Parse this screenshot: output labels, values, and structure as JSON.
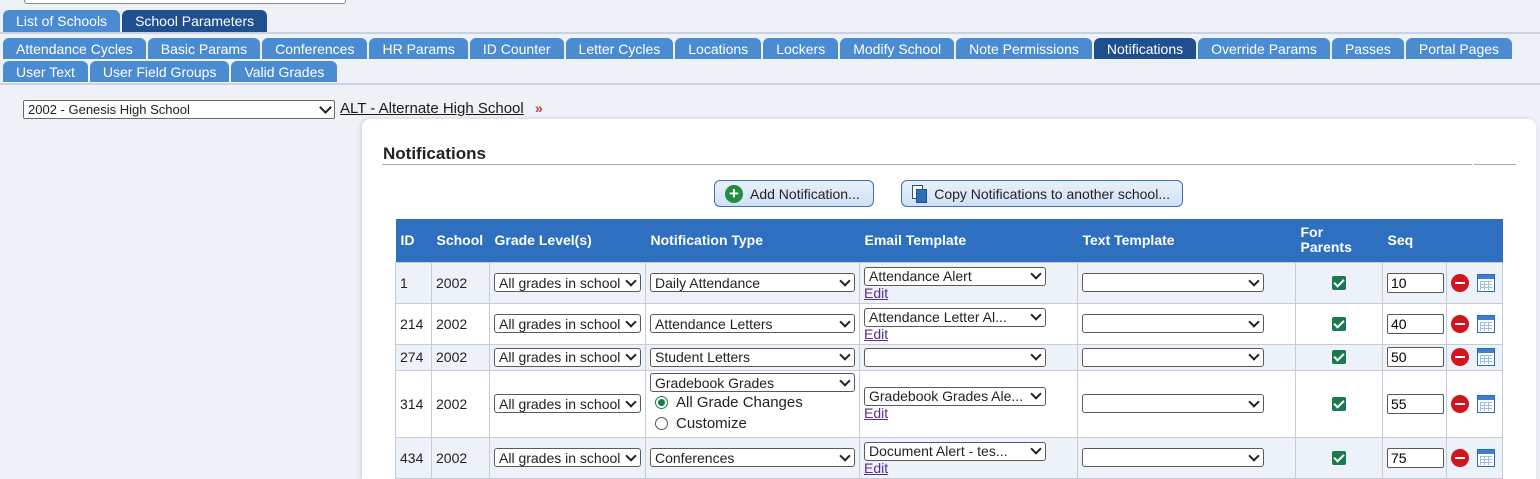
{
  "tabs_top": [
    {
      "label": "List of Schools",
      "active": false
    },
    {
      "label": "School Parameters",
      "active": true
    }
  ],
  "tabs_sub": [
    {
      "label": "Attendance Cycles"
    },
    {
      "label": "Basic Params"
    },
    {
      "label": "Conferences"
    },
    {
      "label": "HR Params"
    },
    {
      "label": "ID Counter"
    },
    {
      "label": "Letter Cycles"
    },
    {
      "label": "Locations"
    },
    {
      "label": "Lockers"
    },
    {
      "label": "Modify School"
    },
    {
      "label": "Note Permissions"
    },
    {
      "label": "Notifications"
    },
    {
      "label": "Override Params"
    },
    {
      "label": "Passes"
    },
    {
      "label": "Portal Pages"
    }
  ],
  "tabs_sub2": [
    {
      "label": "User Text"
    },
    {
      "label": "User Field Groups"
    },
    {
      "label": "Valid Grades"
    }
  ],
  "school_select": {
    "value": "2002 - Genesis High School"
  },
  "alt_link": "ALT - Alternate High School",
  "alt_arrow": "»",
  "panel": {
    "title": "Notifications",
    "add_button": "Add Notification...",
    "copy_button": "Copy Notifications to another school..."
  },
  "table": {
    "headers": {
      "id": "ID",
      "school": "School",
      "grade": "Grade Level(s)",
      "ntype": "Notification Type",
      "email": "Email Template",
      "text": "Text Template",
      "parents": "For Parents",
      "seq": "Seq"
    },
    "edit_label": "Edit",
    "rows": [
      {
        "id": "1",
        "school": "2002",
        "grade": "All grades in school",
        "ntype": "Daily Attendance",
        "email": "Attendance Alert",
        "text": "",
        "parents": true,
        "seq": "10"
      },
      {
        "id": "214",
        "school": "2002",
        "grade": "All grades in school",
        "ntype": "Attendance Letters",
        "email": "Attendance Letter Al...",
        "text": "",
        "parents": true,
        "seq": "40"
      },
      {
        "id": "274",
        "school": "2002",
        "grade": "All grades in school",
        "ntype": "Student Letters",
        "email": "",
        "text": "",
        "parents": true,
        "seq": "50"
      },
      {
        "id": "314",
        "school": "2002",
        "grade": "All grades in school",
        "ntype": "Gradebook Grades",
        "email": "Gradebook Grades Ale...",
        "text": "",
        "parents": true,
        "seq": "55",
        "radio_all": "All Grade Changes",
        "radio_custom": "Customize"
      },
      {
        "id": "434",
        "school": "2002",
        "grade": "All grades in school",
        "ntype": "Conferences",
        "email": "Document Alert - tes...",
        "text": "",
        "parents": true,
        "seq": "75"
      }
    ]
  }
}
